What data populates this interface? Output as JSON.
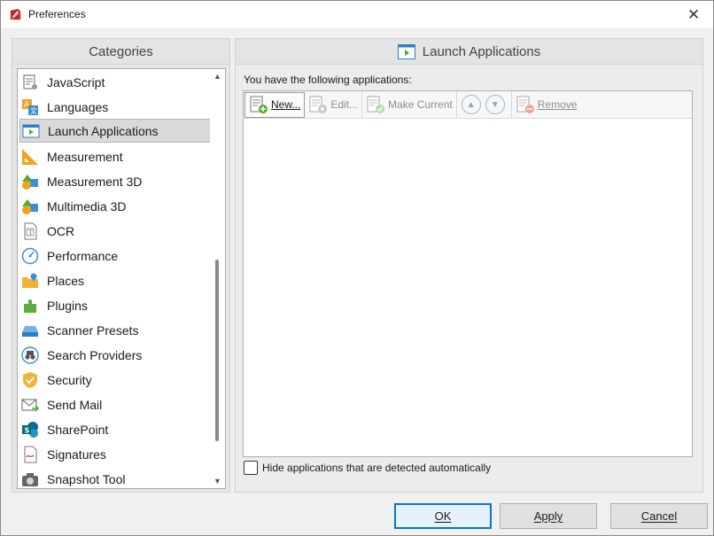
{
  "window": {
    "title": "Preferences"
  },
  "categories_panel": {
    "header": "Categories",
    "items": [
      {
        "label": "JavaScript",
        "icon": "script-icon"
      },
      {
        "label": "Languages",
        "icon": "language-icon"
      },
      {
        "label": "Launch Applications",
        "icon": "launch-applications-icon",
        "selected": true
      },
      {
        "label": "Measurement",
        "icon": "ruler-icon"
      },
      {
        "label": "Measurement 3D",
        "icon": "shapes-3d-icon"
      },
      {
        "label": "Multimedia 3D",
        "icon": "multimedia-3d-icon"
      },
      {
        "label": "OCR",
        "icon": "ocr-icon"
      },
      {
        "label": "Performance",
        "icon": "gauge-icon"
      },
      {
        "label": "Places",
        "icon": "folder-pin-icon"
      },
      {
        "label": "Plugins",
        "icon": "puzzle-icon"
      },
      {
        "label": "Scanner Presets",
        "icon": "scanner-icon"
      },
      {
        "label": "Search Providers",
        "icon": "binoculars-icon"
      },
      {
        "label": "Security",
        "icon": "shield-icon"
      },
      {
        "label": "Send Mail",
        "icon": "envelope-icon"
      },
      {
        "label": "SharePoint",
        "icon": "sharepoint-icon"
      },
      {
        "label": "Signatures",
        "icon": "signature-icon"
      },
      {
        "label": "Snapshot Tool",
        "icon": "camera-icon"
      }
    ]
  },
  "launch_panel": {
    "header": "Launch Applications",
    "description": "You have the following applications:",
    "toolbar": {
      "new_label": "New...",
      "edit_label": "Edit...",
      "make_current_label": "Make Current",
      "remove_label": "Remove"
    },
    "hide_checkbox_label": "Hide applications that are detected automatically",
    "hide_checkbox_checked": false
  },
  "footer": {
    "ok_label": "OK",
    "apply_label": "Apply",
    "cancel_label": "Cancel"
  },
  "colors": {
    "accent": "#0078d7",
    "selection_bg": "#d9d9d9",
    "title_icon": "#c0282d"
  }
}
